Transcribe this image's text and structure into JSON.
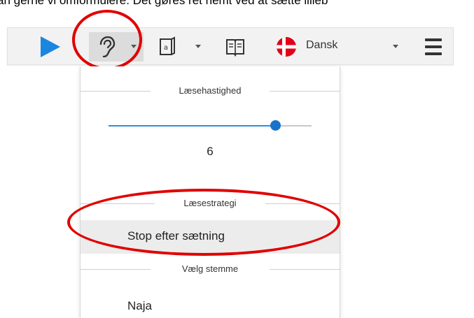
{
  "top_text": "an gerne vi omformulere. Det gøres ret nemt ved at sætte lilleb",
  "toolbar": {
    "play_icon": "play-icon",
    "ear_icon": "ear-icon",
    "page_icon": "page-icon",
    "book_icon": "book-icon",
    "flag_icon": "danish-flag-icon",
    "language_label": "Dansk",
    "menu_icon": "hamburger-menu-icon"
  },
  "dropdown": {
    "speed_header": "Læsehastighed",
    "speed_value": "6",
    "speed_fraction": 0.82,
    "strategy_header": "Læsestrategi",
    "strategy_option": "Stop efter sætning",
    "voice_header": "Vælg stemme",
    "voice_option": "Naja"
  },
  "colors": {
    "accent_blue": "#2f8fd8",
    "annotation_red": "#e00000",
    "flag_red": "#e3001b"
  }
}
